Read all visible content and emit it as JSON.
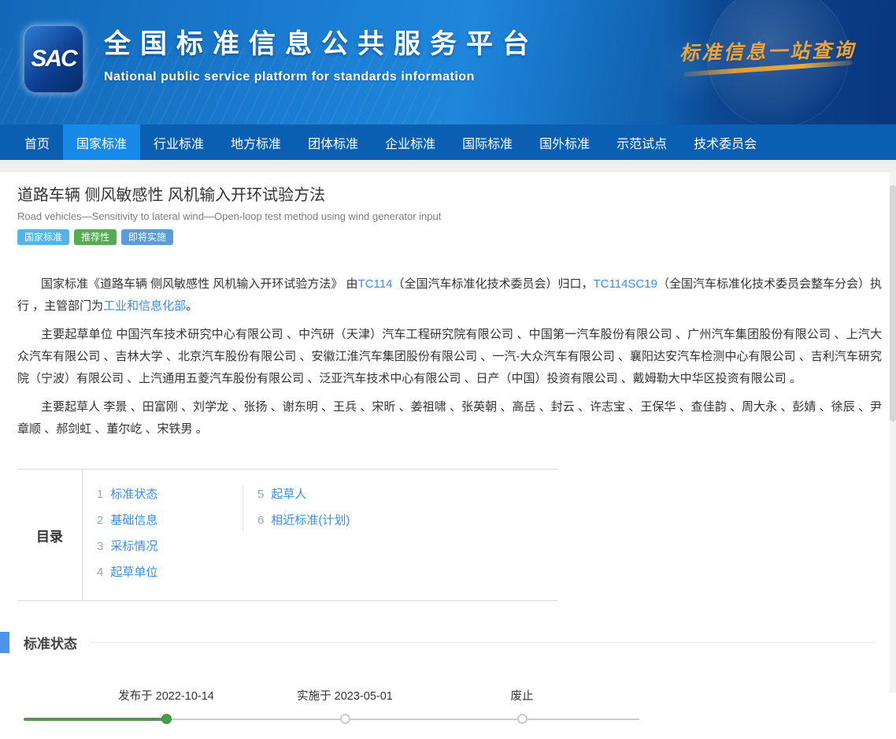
{
  "header": {
    "logo_text": "SAC",
    "title": "全国标准信息公共服务平台",
    "subtitle": "National public service platform  for standards information",
    "slogan": "标准信息一站查询"
  },
  "nav": {
    "items": [
      {
        "label": "首页",
        "active": false
      },
      {
        "label": "国家标准",
        "active": true
      },
      {
        "label": "行业标准",
        "active": false
      },
      {
        "label": "地方标准",
        "active": false
      },
      {
        "label": "团体标准",
        "active": false
      },
      {
        "label": "企业标准",
        "active": false
      },
      {
        "label": "国际标准",
        "active": false
      },
      {
        "label": "国外标准",
        "active": false
      },
      {
        "label": "示范试点",
        "active": false
      },
      {
        "label": "技术委员会",
        "active": false
      }
    ],
    "active_color": "#1789e8",
    "bar_color": "#0a5fb2"
  },
  "standard": {
    "title_zh": "道路车辆 侧风敏感性 风机输入开环试验方法",
    "title_en": "Road vehicles—Sensitivity to lateral wind—Open-loop test method using wind generator input",
    "badges": [
      {
        "label": "国家标准",
        "color": "#51b5e9"
      },
      {
        "label": "推荐性",
        "color": "#53ae53"
      },
      {
        "label": "即将实施",
        "color": "#5b9bdb"
      }
    ],
    "intro": {
      "prefix": "国家标准《道路车辆 侧风敏感性 风机输入开环试验方法》 由",
      "link1": "TC114",
      "mid1": "（全国汽车标准化技术委员会）归口，",
      "link2": "TC114SC19",
      "mid2": "（全国汽车标准化技术委员会整车分会）执行 ，主管部门为",
      "link3": "工业和信息化部",
      "suffix": "。"
    },
    "drafting_units": "主要起草单位 中国汽车技术研究中心有限公司 、中汽研（天津）汽车工程研究院有限公司 、中国第一汽车股份有限公司 、广州汽车集团股份有限公司 、上汽大众汽车有限公司 、吉林大学 、北京汽车股份有限公司 、安徽江淮汽车集团股份有限公司 、一汽-大众汽车有限公司 、襄阳达安汽车检测中心有限公司 、吉利汽车研究院（宁波）有限公司 、上汽通用五菱汽车股份有限公司 、泛亚汽车技术中心有限公司 、日产（中国）投资有限公司 、戴姆勒大中华区投资有限公司 。",
    "drafters": "主要起草人 李景 、田富刚 、刘学龙 、张扬 、谢东明 、王兵 、宋昕 、姜祖啸 、张英朝 、高岳 、封云 、许志宝 、王保华 、查佳韵 、周大永 、彭婧 、徐辰 、尹章顺 、郝剑虹 、董尔屹 、宋铁男 。"
  },
  "toc": {
    "label": "目录",
    "col1": [
      {
        "num": "1",
        "label": "标准状态"
      },
      {
        "num": "2",
        "label": "基础信息"
      },
      {
        "num": "3",
        "label": "采标情况"
      },
      {
        "num": "4",
        "label": "起草单位"
      }
    ],
    "col2": [
      {
        "num": "5",
        "label": "起草人"
      },
      {
        "num": "6",
        "label": "相近标准(计划)"
      }
    ]
  },
  "status_section": {
    "title": "标准状态",
    "accent_color": "#4d94e8",
    "timeline": [
      {
        "label": "发布于 2022-10-14",
        "state": "done"
      },
      {
        "label": "实施于 2023-05-01",
        "state": "pending"
      },
      {
        "label": "废止",
        "state": "pending"
      }
    ],
    "done_color": "#44a044"
  }
}
